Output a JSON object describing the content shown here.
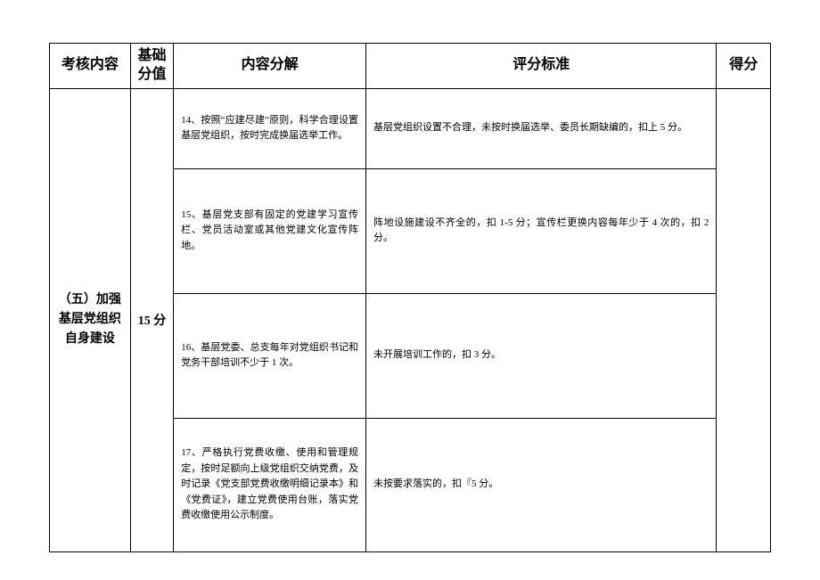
{
  "headers": {
    "category": "考核内容",
    "base_score": "基础分值",
    "breakdown": "内容分解",
    "criteria": "评分标准",
    "result": "得分"
  },
  "section": {
    "category": "（五）加强基层党组织自身建设",
    "score": "15 分",
    "rows": [
      {
        "breakdown": "14、按照“应建尽建”原则，科学合理设置基层党组织，按时完成换届选举工作。",
        "criteria": "基层党组织设置不合理，未按时换届选举、委员长期缺编的，扣上 5 分。"
      },
      {
        "breakdown": "15、基层党支部有固定的党建学习宣传栏、党员活动室或其他党建文化宣传阵地。",
        "criteria": "阵地设施建设不齐全的，扣 1-5 分；宣传栏更换内容每年少于 4 次的，扣 2 分。"
      },
      {
        "breakdown": "16、基层党委、总支每年对党组织书记和党务干部培训不少于 1 次。",
        "criteria": "未开展培训工作的，扣 3 分。"
      },
      {
        "breakdown": "17、严格执行党费收缴、使用和管理规定，按时足额向上级党组织交纳党费，及时记录《党支部党费收缴明细记录本》和《党费证》，建立党费使用台账，落实党费收缴使用公示制度。",
        "criteria": "未按要求落实的，扣『5 分。"
      }
    ]
  }
}
